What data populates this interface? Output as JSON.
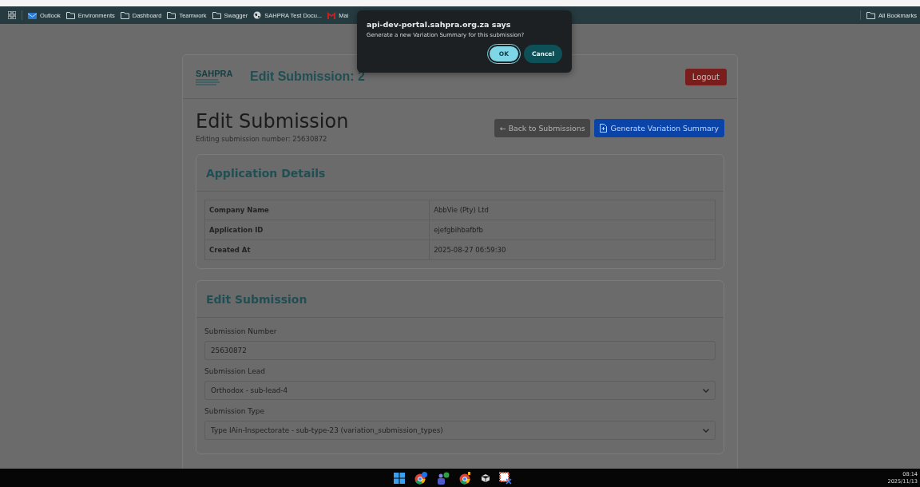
{
  "bookmarks_bar": {
    "items": [
      {
        "label": "Outlook",
        "kind": "app"
      },
      {
        "label": "Environments",
        "kind": "folder"
      },
      {
        "label": "Dashboard",
        "kind": "folder"
      },
      {
        "label": "Teamwork",
        "kind": "folder"
      },
      {
        "label": "Swagger",
        "kind": "folder"
      },
      {
        "label": "SAHPRA Test Docu...",
        "kind": "globe"
      },
      {
        "label": "Mai",
        "kind": "mail"
      }
    ],
    "all_bookmarks": "All Bookmarks"
  },
  "header": {
    "logo": "SAHPRA",
    "title": "Edit Submission: 2",
    "logout": "Logout"
  },
  "page": {
    "title": "Edit Submission",
    "subtitle": "Editing submission number: 25630872",
    "back_button": "← Back to Submissions",
    "generate_button": "Generate Variation Summary"
  },
  "application_details": {
    "title": "Application Details",
    "rows": [
      {
        "label": "Company Name",
        "value": "AbbVie (Pty) Ltd"
      },
      {
        "label": "Application ID",
        "value": "ejefgbihbafbfb"
      },
      {
        "label": "Created At",
        "value": "2025-08-27 06:59:30"
      }
    ]
  },
  "edit_submission": {
    "title": "Edit Submission",
    "fields": [
      {
        "label": "Submission Number",
        "value": "25630872",
        "kind": "input"
      },
      {
        "label": "Submission Lead",
        "value": "Orthodox - sub-lead-4",
        "kind": "select"
      },
      {
        "label": "Submission Type",
        "value": "Type IAin-Inspectorate - sub-type-23 (variation_submission_types)",
        "kind": "select"
      }
    ]
  },
  "dialog": {
    "title": "api-dev-portal.sahpra.org.za says",
    "message": "Generate a new Variation Summary for this submission?",
    "ok": "OK",
    "cancel": "Cancel"
  },
  "taskbar": {
    "time": "08:14",
    "date": "2025/11/13"
  }
}
